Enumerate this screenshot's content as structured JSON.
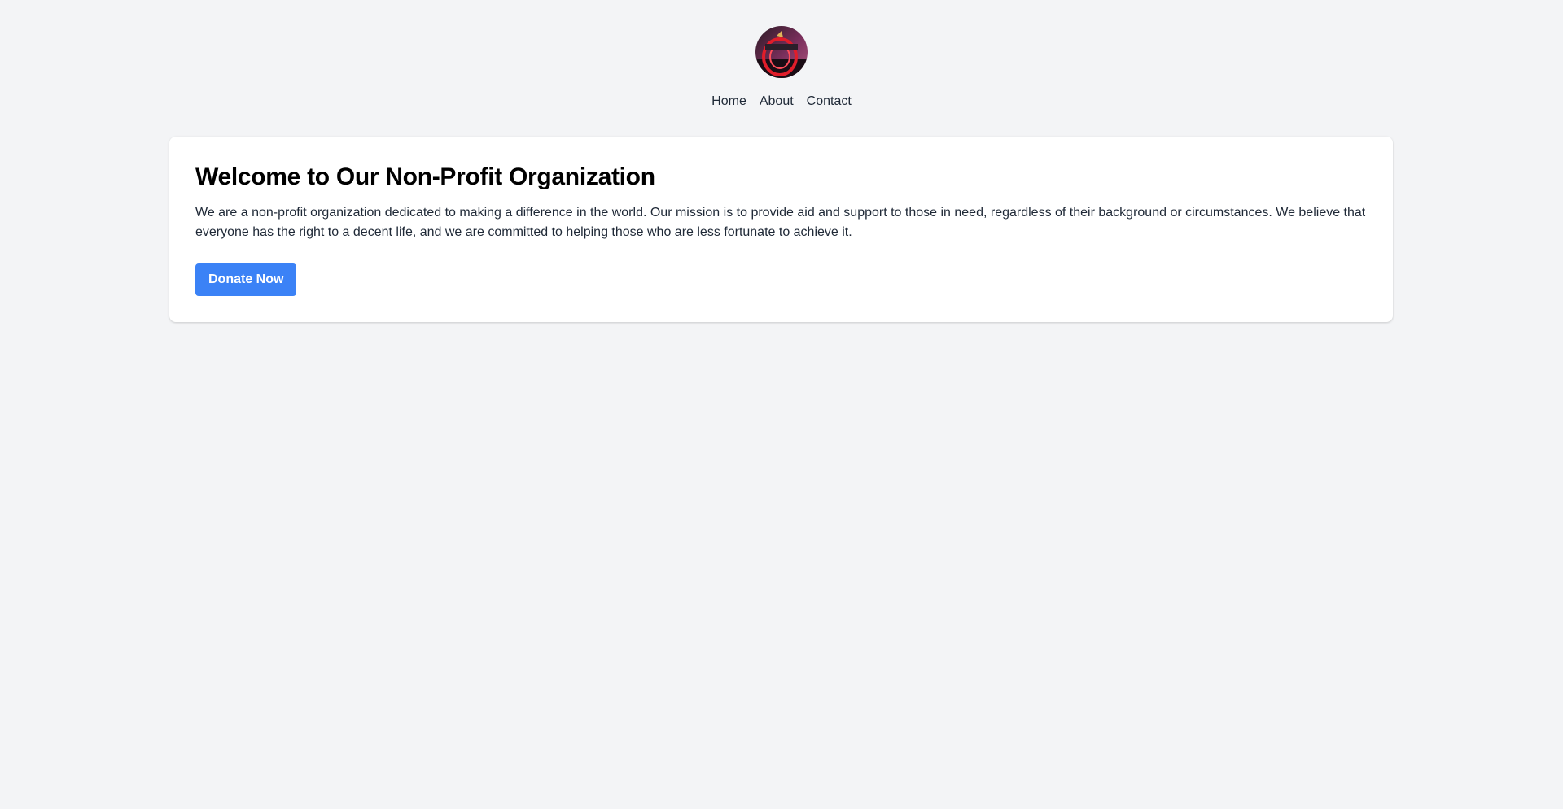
{
  "header": {
    "logo_icon": "organization-logo-icon",
    "nav": [
      {
        "label": "Home"
      },
      {
        "label": "About"
      },
      {
        "label": "Contact"
      }
    ]
  },
  "main": {
    "title": "Welcome to Our Non-Profit Organization",
    "description": "We are a non-profit organization dedicated to making a difference in the world. Our mission is to provide aid and support to those in need, regardless of their background or circumstances. We believe that everyone has the right to a decent life, and we are committed to helping those who are less fortunate to achieve it.",
    "donate_label": "Donate Now"
  },
  "colors": {
    "page_background": "#f3f4f6",
    "card_background": "#ffffff",
    "accent": "#3b82f6",
    "text": "#1f2937"
  }
}
